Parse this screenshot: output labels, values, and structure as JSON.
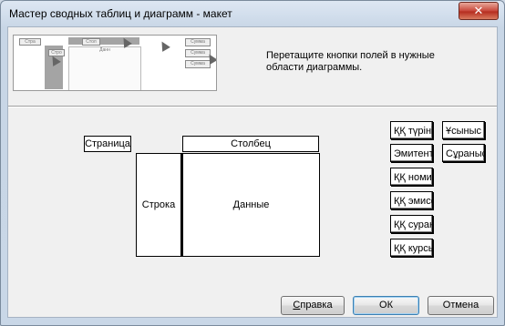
{
  "window": {
    "title": "Мастер сводных таблиц и диаграмм - макет",
    "close_glyph": "✕"
  },
  "preview": {
    "chips": [
      "Стра",
      "Стол",
      "Стро",
      "Данн"
    ],
    "side_chips": [
      "Сумма",
      "Сумма",
      "Сумма"
    ]
  },
  "instructions": "Перетащите кнопки полей в нужные области диаграммы.",
  "layout": {
    "page_label": "Страница",
    "column_label": "Столбец",
    "row_label": "Строка",
    "data_label": "Данные"
  },
  "fields": {
    "col1": [
      "ҚҚ түріні",
      "Эмитент",
      "ҚҚ номин",
      "ҚҚ эмисс",
      "ҚҚ сурана",
      "ҚҚ курсы"
    ],
    "col2": [
      "Ұсыныс",
      "Сұраныс"
    ]
  },
  "buttons": {
    "help": "Справка",
    "help_key": "С",
    "help_rest": "правка",
    "ok": "ОК",
    "cancel": "Отмена"
  }
}
